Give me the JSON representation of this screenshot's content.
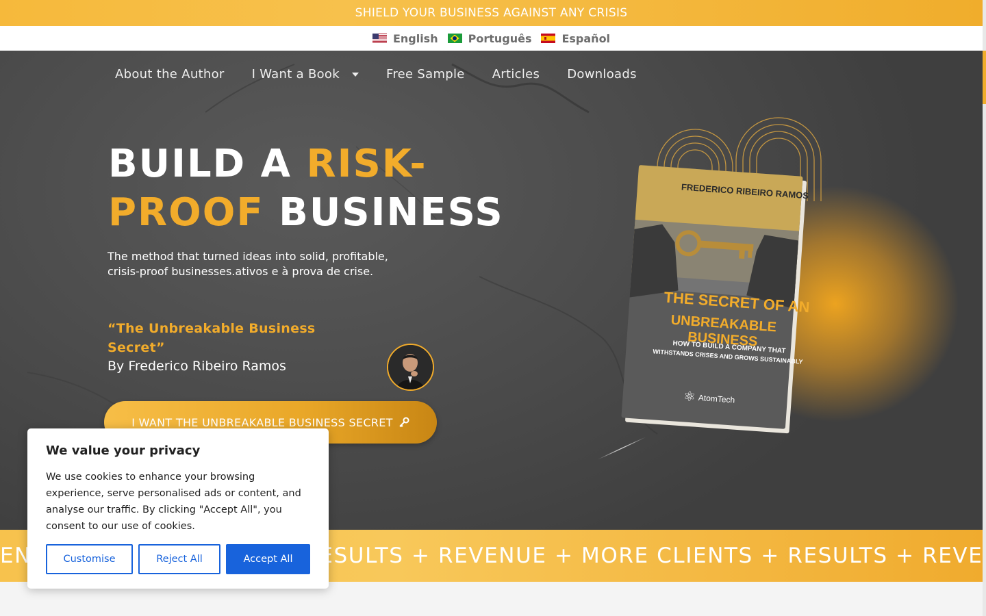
{
  "banner": {
    "text": "SHIELD YOUR BUSINESS AGAINST ANY CRISIS"
  },
  "languages": [
    {
      "label": "English",
      "flag": "us-flag-icon"
    },
    {
      "label": "Português",
      "flag": "brazil-flag-icon"
    },
    {
      "label": "Español",
      "flag": "spain-flag-icon"
    }
  ],
  "nav": {
    "items": [
      "About the Author",
      "I Want a Book",
      "Free Sample",
      "Articles",
      "Downloads"
    ]
  },
  "hero": {
    "headline_part1": "BUILD A ",
    "headline_accent1": "RISK-",
    "headline_accent2": "PROOF",
    "headline_part2": " BUSINESS",
    "subtitle": "The method that turned ideas into solid, profitable, crisis-proof businesses.ativos e à prova de crise.",
    "book_title": " “The Unbreakable Business Secret”",
    "byline": "By Frederico Ribeiro Ramos",
    "cta": "I WANT THE UNBREAKABLE BUSINESS SECRET",
    "cta_icon": "key-icon"
  },
  "book": {
    "author": "FREDERICO RIBEIRO RAMOS",
    "title_line1": "THE SECRET OF AN",
    "title_line2": "UNBREAKABLE BUSINESS",
    "subtitle_line1": "HOW TO BUILD A COMPANY THAT",
    "subtitle_line2": "WITHSTANDS CRISES AND GROWS SUSTAINABLY",
    "publisher": "AtomTech"
  },
  "marquee": {
    "text": "ENUE + MORE CLIENTS + RESULTS + REVENUE + MORE CLIENTS + RESULTS + REVENUE + MORE CLIENTS + RESULTS"
  },
  "cookie": {
    "title": "We value your privacy",
    "body": "We use cookies to enhance your browsing experience, serve personalised ads or content, and analyse our traffic. By clicking \"Accept All\", you consent to our use of cookies.",
    "customise": "Customise",
    "reject": "Reject All",
    "accept": "Accept All"
  },
  "colors": {
    "accent": "#f2ac2b",
    "cookie_blue": "#1863dc"
  }
}
